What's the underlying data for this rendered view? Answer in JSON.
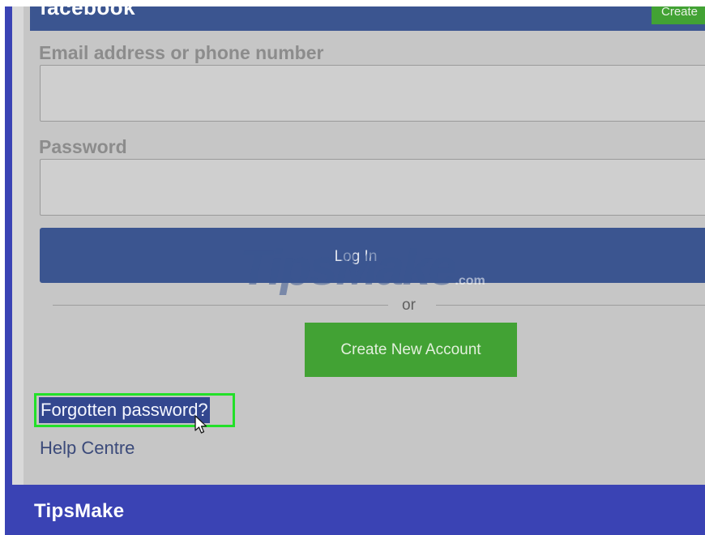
{
  "header": {
    "logo_text": "facebook",
    "create_label": "Create"
  },
  "form": {
    "email_label": "Email address or phone number",
    "email_value": "",
    "password_label": "Password",
    "password_value": "",
    "login_label": "Log In",
    "or_text": "or",
    "create_account_label": "Create New Account",
    "forgot_password_label": "Forgotten password?",
    "help_label": "Help Centre"
  },
  "watermark": {
    "text": "TipsMake",
    "suffix": ".com"
  },
  "footer": {
    "brand": "TipsMake"
  },
  "colors": {
    "facebook_blue": "#3b5590",
    "create_green": "#42a234",
    "highlight_green": "#22e028",
    "frame_blue": "#3a43b4",
    "screen_gray": "#c6c6c6"
  },
  "icons": {
    "cursor": "mouse-pointer-icon"
  }
}
